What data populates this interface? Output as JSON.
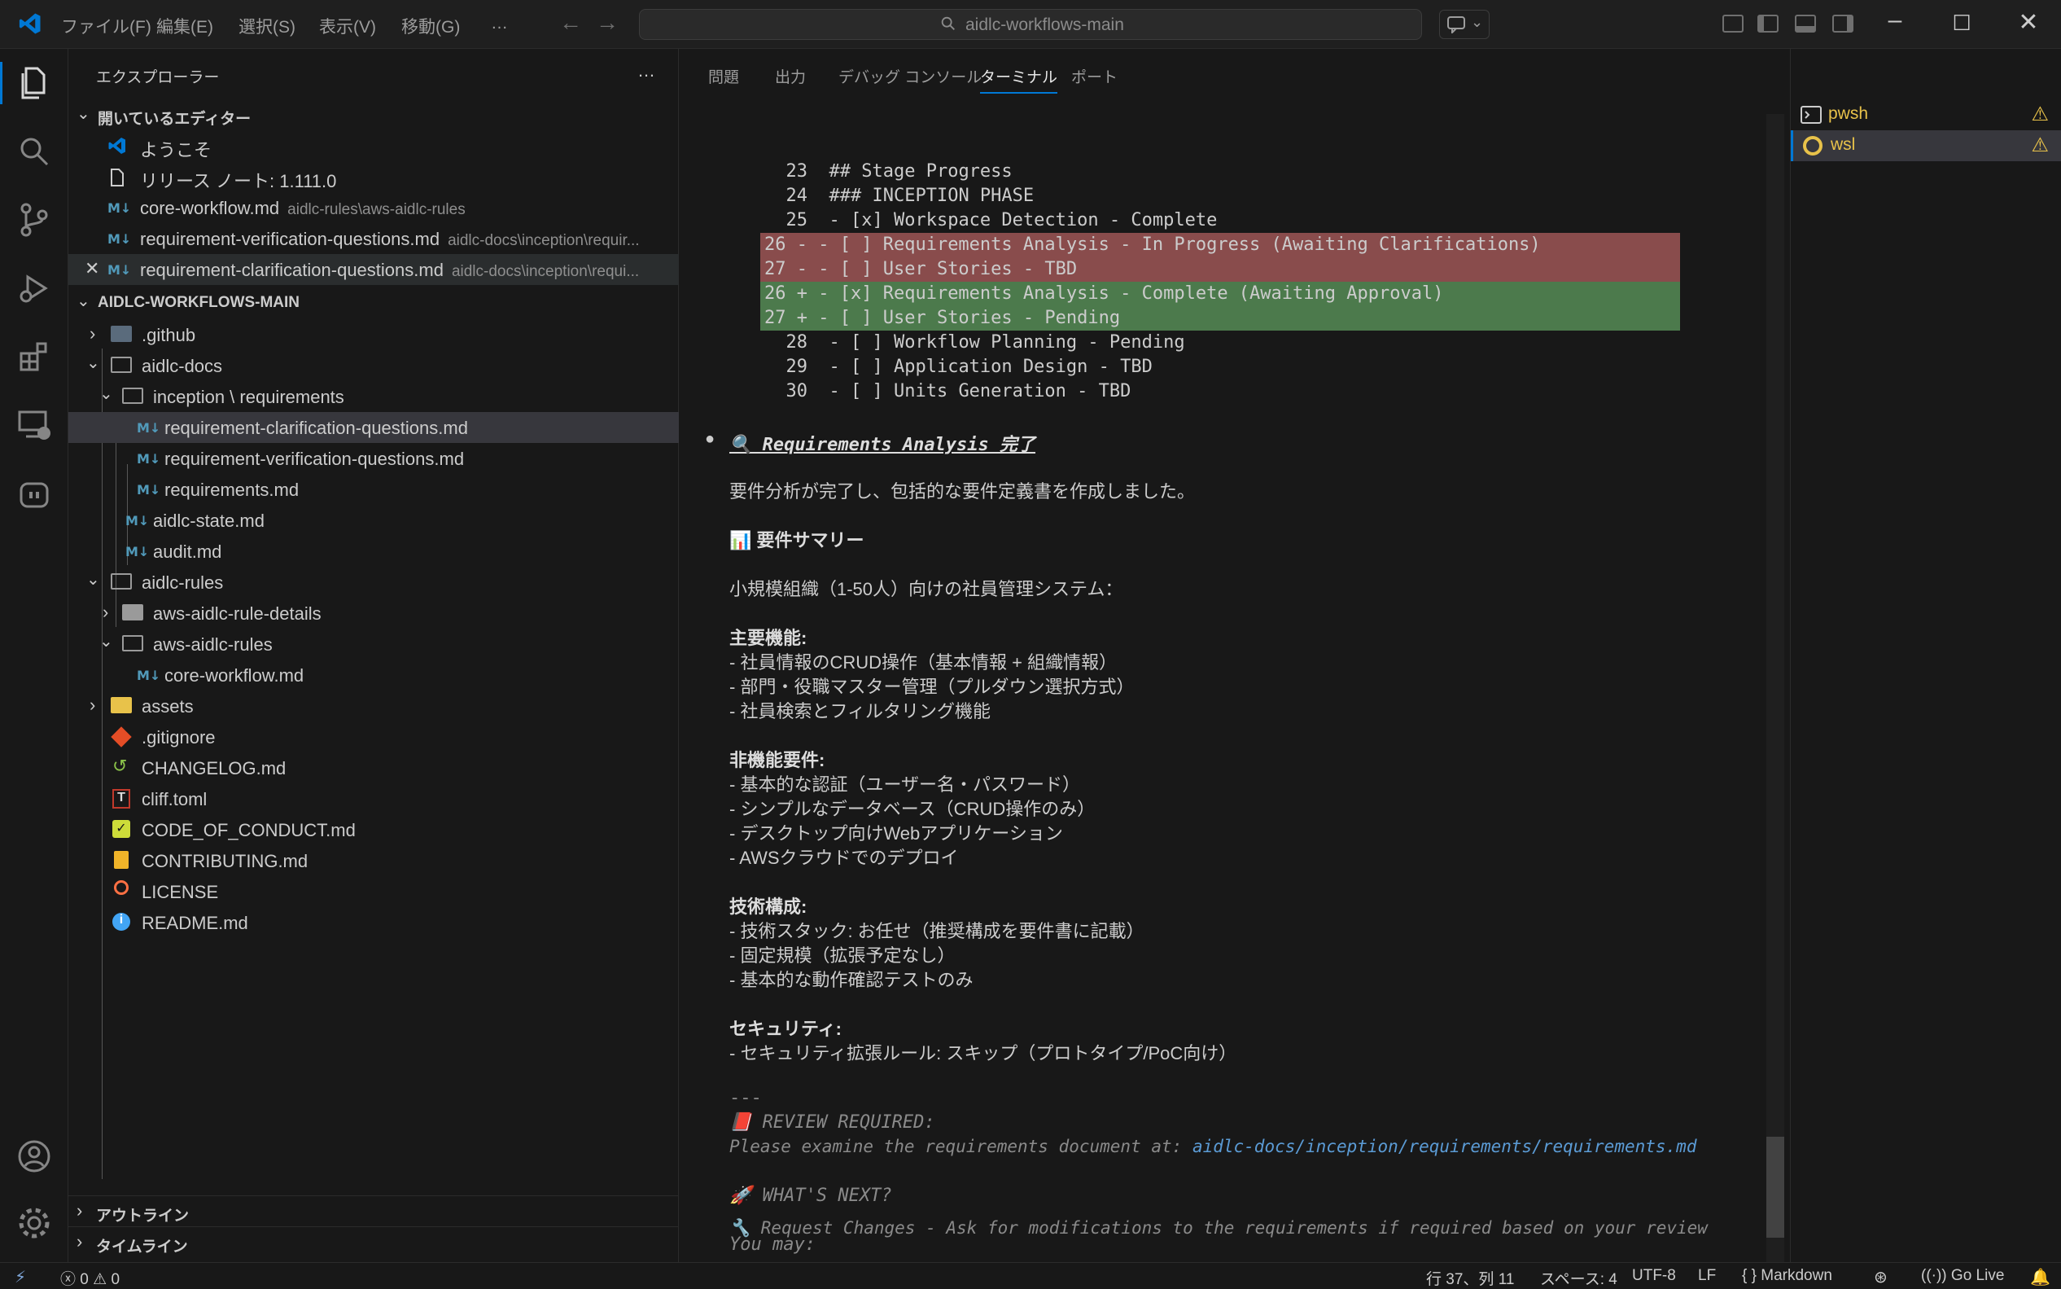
{
  "titlebar": {
    "menus": [
      "ファイル(F)",
      "編集(E)",
      "選択(S)",
      "表示(V)",
      "移動(G)",
      "…"
    ],
    "search_text": "aidlc-workflows-main"
  },
  "sidebar": {
    "title": "エクスプローラー",
    "more": "…",
    "open_editors_header": "開いているエディター",
    "open_editors": [
      {
        "label": "ようこそ",
        "desc": ""
      },
      {
        "label": "リリース ノート: 1.111.0",
        "desc": ""
      },
      {
        "label": "core-workflow.md",
        "desc": "aidlc-rules\\aws-aidlc-rules"
      },
      {
        "label": "requirement-verification-questions.md",
        "desc": "aidlc-docs\\inception\\requir..."
      },
      {
        "label": "requirement-clarification-questions.md",
        "desc": "aidlc-docs\\inception\\requi..."
      }
    ],
    "workspace_header": "AIDLC-WORKFLOWS-MAIN",
    "tree": [
      {
        "label": ".github"
      },
      {
        "label": "aidlc-docs"
      },
      {
        "label": "inception \\ requirements"
      },
      {
        "label": "requirement-clarification-questions.md"
      },
      {
        "label": "requirement-verification-questions.md"
      },
      {
        "label": "requirements.md"
      },
      {
        "label": "aidlc-state.md"
      },
      {
        "label": "audit.md"
      },
      {
        "label": "aidlc-rules"
      },
      {
        "label": "aws-aidlc-rule-details"
      },
      {
        "label": "aws-aidlc-rules"
      },
      {
        "label": "core-workflow.md"
      },
      {
        "label": "assets"
      },
      {
        "label": ".gitignore"
      },
      {
        "label": "CHANGELOG.md"
      },
      {
        "label": "cliff.toml"
      },
      {
        "label": "CODE_OF_CONDUCT.md"
      },
      {
        "label": "CONTRIBUTING.md"
      },
      {
        "label": "LICENSE"
      },
      {
        "label": "README.md"
      }
    ],
    "outline": "アウトライン",
    "timeline": "タイムライン"
  },
  "panel": {
    "tabs": [
      "問題",
      "出力",
      "デバッグ コンソール",
      "ターミナル",
      "ポート"
    ],
    "add": "+"
  },
  "terminal": {
    "diff_lines": [
      {
        "num": "23",
        "text": "## Stage Progress"
      },
      {
        "num": "24",
        "text": "### INCEPTION PHASE"
      },
      {
        "num": "25",
        "text": "- [x] Workspace Detection - Complete"
      },
      {
        "num": "26 -",
        "text": "- [ ] Requirements Analysis - In Progress (Awaiting Clarifications)"
      },
      {
        "num": "27 -",
        "text": "- [ ] User Stories - TBD"
      },
      {
        "num": "26 +",
        "text": "- [x] Requirements Analysis - Complete (Awaiting Approval)"
      },
      {
        "num": "27 +",
        "text": "- [ ] User Stories - Pending"
      },
      {
        "num": "28",
        "text": "- [ ] Workflow Planning - Pending"
      },
      {
        "num": "29",
        "text": "- [ ] Application Design - TBD"
      },
      {
        "num": "30",
        "text": "- [ ] Units Generation - TBD"
      }
    ],
    "heading": "🔍 Requirements Analysis 完了",
    "intro": "要件分析が完了し、包括的な要件定義書を作成しました。",
    "summary_title": "📊 要件サマリー",
    "summary_desc": "小規模組織（1-50人）向けの社員管理システム：",
    "func_title": "主要機能:",
    "func_items": [
      "- 社員情報のCRUD操作（基本情報 + 組織情報）",
      "- 部門・役職マスター管理（プルダウン選択方式）",
      "- 社員検索とフィルタリング機能"
    ],
    "nonfunc_title": "非機能要件:",
    "nonfunc_items": [
      "- 基本的な認証（ユーザー名・パスワード）",
      "- シンプルなデータベース（CRUD操作のみ）",
      "- デスクトップ向けWebアプリケーション",
      "- AWSクラウドでのデプロイ"
    ],
    "tech_title": "技術構成:",
    "tech_items": [
      "- 技術スタック: お任せ（推奨構成を要件書に記載）",
      "- 固定規模（拡張予定なし）",
      "- 基本的な動作確認テストのみ"
    ],
    "sec_title": "セキュリティ:",
    "sec_items": [
      "- セキュリティ拡張ルール: スキップ（プロトタイプ/PoC向け）"
    ],
    "hr": "---",
    "review": "📕 REVIEW REQUIRED:",
    "examine_prefix": "Please examine the requirements document at: ",
    "examine_link": "aidlc-docs/inception/requirements/requirements.md",
    "next": "🚀 WHAT'S NEXT?",
    "you_may": "You may:",
    "request": "🔧 Request Changes - Ask for modifications to the requirements if required based on your review"
  },
  "terminal_list": [
    {
      "name": "pwsh",
      "warn": "⚠"
    },
    {
      "name": "wsl",
      "warn": "⚠"
    }
  ],
  "statusbar": {
    "errors": "0",
    "warnings": "0",
    "position": "行 37、列 11",
    "spaces": "スペース: 4",
    "encoding": "UTF-8",
    "eol": "LF",
    "language_brace": "{ }",
    "language": "Markdown",
    "golive": "Go Live"
  }
}
